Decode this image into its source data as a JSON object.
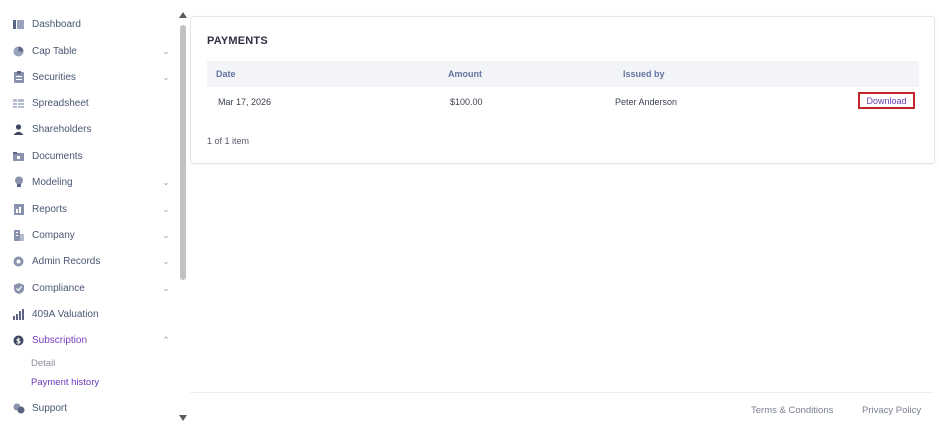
{
  "sidebar": {
    "items": [
      {
        "label": "Dashboard",
        "icon": "dashboard-icon",
        "chevron": ""
      },
      {
        "label": "Cap Table",
        "icon": "pie-chart-icon",
        "chevron": "⌄"
      },
      {
        "label": "Securities",
        "icon": "clipboard-icon",
        "chevron": "⌄"
      },
      {
        "label": "Spreadsheet",
        "icon": "spreadsheet-icon",
        "chevron": ""
      },
      {
        "label": "Shareholders",
        "icon": "person-icon",
        "chevron": ""
      },
      {
        "label": "Documents",
        "icon": "folder-icon",
        "chevron": ""
      },
      {
        "label": "Modeling",
        "icon": "lightbulb-icon",
        "chevron": "⌄"
      },
      {
        "label": "Reports",
        "icon": "report-icon",
        "chevron": "⌄"
      },
      {
        "label": "Company",
        "icon": "building-icon",
        "chevron": "⌄"
      },
      {
        "label": "Admin Records",
        "icon": "admin-records-icon",
        "chevron": "⌄"
      },
      {
        "label": "Compliance",
        "icon": "shield-check-icon",
        "chevron": "⌄"
      },
      {
        "label": "409A Valuation",
        "icon": "valuation-icon",
        "chevron": ""
      },
      {
        "label": "Subscription",
        "icon": "dollar-circle-icon",
        "chevron": "⌃"
      },
      {
        "label": "Support",
        "icon": "support-icon",
        "chevron": ""
      }
    ],
    "subscription_sub": [
      {
        "label": "Detail"
      },
      {
        "label": "Payment history"
      }
    ]
  },
  "payments": {
    "title": "PAYMENTS",
    "columns": {
      "date": "Date",
      "amount": "Amount",
      "issued_by": "Issued by"
    },
    "rows": [
      {
        "date": "Mar 17, 2026",
        "amount": "$100.00",
        "issued_by": "Peter Anderson",
        "action": "Download"
      }
    ],
    "pagination": "1 of 1 item"
  },
  "footer": {
    "terms": "Terms & Conditions",
    "privacy": "Privacy Policy"
  },
  "colors": {
    "accent": "#7a3ec2",
    "highlight_border": "#c2272d",
    "header_text": "#6276a1"
  }
}
